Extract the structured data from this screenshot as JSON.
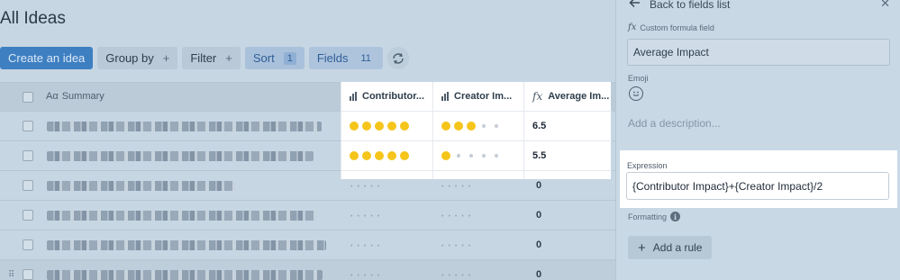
{
  "page": {
    "title": "All Ideas"
  },
  "toolbar": {
    "create": "Create an idea",
    "group_by": "Group by",
    "filter": "Filter",
    "sort": "Sort",
    "sort_count": "1",
    "fields": "Fields",
    "fields_count": "11",
    "plus": "+"
  },
  "grid": {
    "summary_header": "Summary",
    "summary_prefix": "Aα",
    "dimmed_rows": [
      {
        "value": "0"
      },
      {
        "value": "0"
      },
      {
        "value": "0"
      },
      {
        "value": "0"
      }
    ]
  },
  "highlight_table": {
    "columns": [
      {
        "label": "Contributor...",
        "icon": "bar-chart-icon"
      },
      {
        "label": "Creator Im...",
        "icon": "bar-chart-icon"
      },
      {
        "label": "Average Im...",
        "icon": "fx-icon"
      }
    ],
    "rows": [
      {
        "contributor": 5,
        "creator": 3,
        "average": "6.5"
      },
      {
        "contributor": 5,
        "creator": 1,
        "average": "5.5"
      }
    ],
    "max_rating": 5
  },
  "panel": {
    "back_label": "Back to fields list",
    "field_type": "Custom formula field",
    "field_type_icon": "fx",
    "name_value": "Average Impact",
    "emoji_label": "Emoji",
    "description_placeholder": "Add a description...",
    "expression_label": "Expression",
    "expression_value": "{Contributor Impact}+{Creator Impact}/2",
    "formatting_label": "Formatting",
    "add_rule_label": "Add a rule"
  },
  "colors": {
    "rating_filled": "#f5c51b",
    "rating_empty": "#c6ccd4",
    "primary_button": "#3e7fc2",
    "overlay": "#c8d7e3"
  }
}
